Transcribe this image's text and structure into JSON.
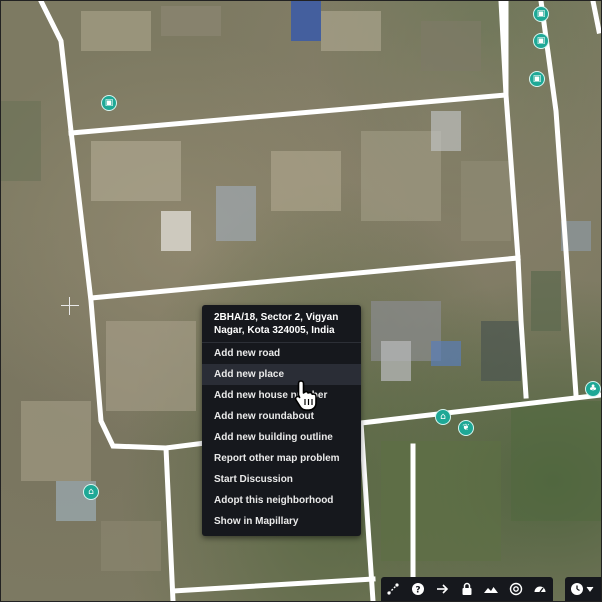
{
  "context_menu": {
    "address": "2BHA/18, Sector 2, Vigyan Nagar, Kota 324005, India",
    "items": [
      {
        "label": "Add new road"
      },
      {
        "label": "Add new place"
      },
      {
        "label": "Add new house number"
      },
      {
        "label": "Add new roundabout"
      },
      {
        "label": "Add new building outline"
      },
      {
        "label": "Report other map problem"
      },
      {
        "label": "Start Discussion"
      },
      {
        "label": "Adopt this neighborhood"
      },
      {
        "label": "Show in Mapillary"
      }
    ],
    "highlighted_item": "Add new place"
  },
  "toolbar": {
    "buttons": [
      {
        "icon": "measure-icon"
      },
      {
        "icon": "help-icon"
      },
      {
        "icon": "arrow-right-icon"
      },
      {
        "icon": "lock-icon"
      },
      {
        "icon": "terrain-icon"
      },
      {
        "icon": "at-sign-icon"
      },
      {
        "icon": "speedometer-icon"
      }
    ]
  },
  "layer_switch": {
    "icon": "clock-icon"
  },
  "map_pois": [
    {
      "icon": "shopping-bag-icon"
    },
    {
      "icon": "shopping-bag-icon"
    },
    {
      "icon": "shopping-bag-icon"
    },
    {
      "icon": "shopping-bag-icon"
    },
    {
      "icon": "bank-icon"
    },
    {
      "icon": "bank-icon"
    },
    {
      "icon": "leaf-icon"
    },
    {
      "icon": "park-icon"
    }
  ],
  "colors": {
    "poi": "#1ea896",
    "menu_background": "#16181d",
    "road": "#ffffff"
  }
}
